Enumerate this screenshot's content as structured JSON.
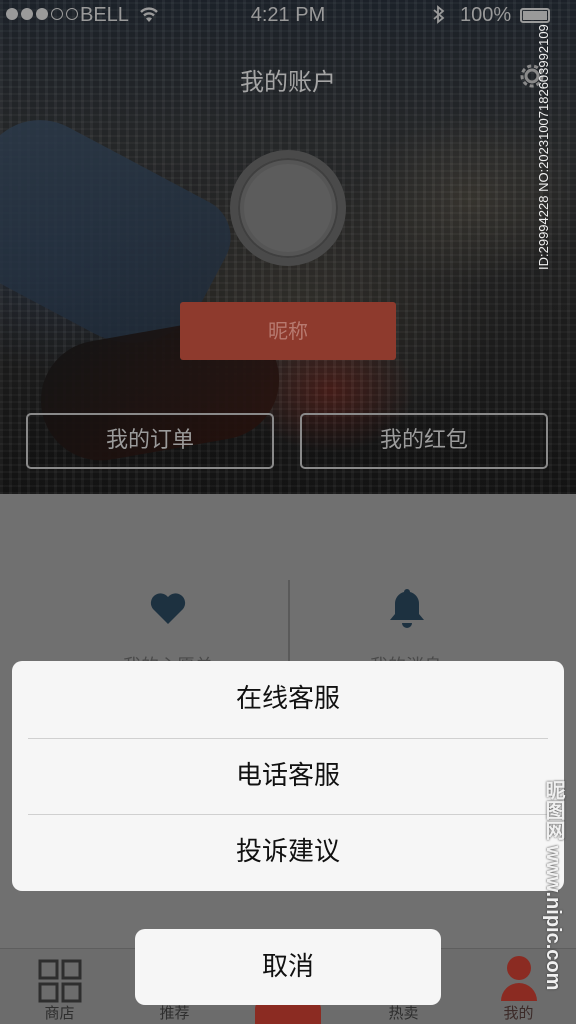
{
  "status_bar": {
    "carrier": "BELL",
    "time": "4:21 PM",
    "battery": "100%"
  },
  "header": {
    "title": "我的账户"
  },
  "profile": {
    "nickname_button": "昵称"
  },
  "quick_buttons": {
    "orders": "我的订单",
    "red_packet": "我的红包"
  },
  "shortcuts": {
    "favorites_label": "我的心愿单",
    "messages_label": "我的消息"
  },
  "action_sheet": {
    "items": [
      "在线客服",
      "电话客服",
      "投诉建议"
    ],
    "cancel": "取消"
  },
  "tab_bar": {
    "items": [
      {
        "label": "商店",
        "icon": "grid-icon"
      },
      {
        "label": "推荐",
        "icon": "recommend-icon"
      },
      {
        "label": "",
        "icon": "center-button"
      },
      {
        "label": "热卖",
        "icon": "hot-icon"
      },
      {
        "label": "我的",
        "icon": "person-icon"
      }
    ]
  },
  "watermark": {
    "id": "ID:29994228 NO:20231007182603992109",
    "site": "昵图网 www.nipic.com"
  },
  "colors": {
    "accent": "#8e3a2d",
    "overlay": "#707070",
    "sheet": "#f6f6f6"
  }
}
